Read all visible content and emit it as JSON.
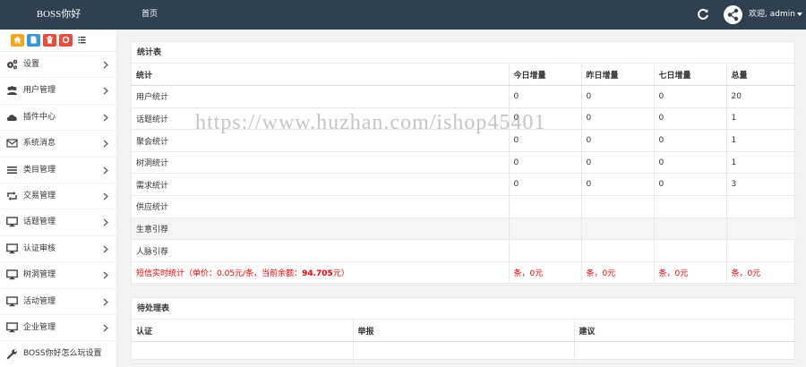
{
  "header": {
    "brand": "BOSS你好",
    "nav_home": "首页",
    "welcome": "欢迎, admin",
    "colors": {
      "bg": "#2f4050",
      "text": "#ffffff"
    }
  },
  "sidebar": {
    "shortcuts": [
      {
        "icon": "home-icon",
        "color": "#f7a51c"
      },
      {
        "icon": "document-icon",
        "color": "#3498db"
      },
      {
        "icon": "trash-icon",
        "color": "#e74c3c"
      },
      {
        "icon": "recycle-icon",
        "color": "#e74c3c"
      },
      {
        "icon": "list-icon",
        "color": "#ffffff"
      }
    ],
    "items": [
      {
        "label": "设置",
        "icon": "gears-icon"
      },
      {
        "label": "用户管理",
        "icon": "users-icon"
      },
      {
        "label": "插件中心",
        "icon": "cloud-icon"
      },
      {
        "label": "系统消息",
        "icon": "envelope-icon"
      },
      {
        "label": "类目管理",
        "icon": "bars-icon"
      },
      {
        "label": "交易管理",
        "icon": "retweet-icon"
      },
      {
        "label": "话题管理",
        "icon": "monitor-icon"
      },
      {
        "label": "认证审核",
        "icon": "monitor-icon"
      },
      {
        "label": "树洞管理",
        "icon": "monitor-icon"
      },
      {
        "label": "活动管理",
        "icon": "monitor-icon"
      },
      {
        "label": "企业管理",
        "icon": "monitor-icon"
      },
      {
        "label": "BOSS你好怎么玩设置",
        "icon": "wrench-icon"
      }
    ]
  },
  "stats": {
    "title": "统计表",
    "headers": [
      "统计",
      "今日增量",
      "昨日增量",
      "七日增量",
      "总量"
    ],
    "rows": [
      {
        "name": "用户统计",
        "today": "0",
        "yesterday": "0",
        "week": "0",
        "total": "20"
      },
      {
        "name": "话题统计",
        "today": "0",
        "yesterday": "0",
        "week": "0",
        "total": "1"
      },
      {
        "name": "聚会统计",
        "today": "0",
        "yesterday": "0",
        "week": "0",
        "total": "1"
      },
      {
        "name": "树洞统计",
        "today": "0",
        "yesterday": "0",
        "week": "0",
        "total": "1"
      },
      {
        "name": "需求统计",
        "today": "0",
        "yesterday": "0",
        "week": "0",
        "total": "3"
      },
      {
        "name": "供应统计",
        "today": "",
        "yesterday": "",
        "week": "",
        "total": ""
      },
      {
        "name": "生意引荐",
        "today": "",
        "yesterday": "",
        "week": "",
        "total": ""
      },
      {
        "name": "人脉引荐",
        "today": "",
        "yesterday": "",
        "week": "",
        "total": ""
      }
    ],
    "sms": {
      "prefix": "短信实时统计（单价：0.05元/条，当前余额：",
      "balance": "94.705",
      "suffix": "元）",
      "today": "条，0元",
      "yesterday": "条，0元",
      "week": "条，0元",
      "total": "条，0元",
      "color": "#ee0000"
    }
  },
  "pending": {
    "title": "待处理表",
    "headers": [
      "认证",
      "举报",
      "建议"
    ]
  },
  "watermark": "https://www.huzhan.com/ishop45401"
}
